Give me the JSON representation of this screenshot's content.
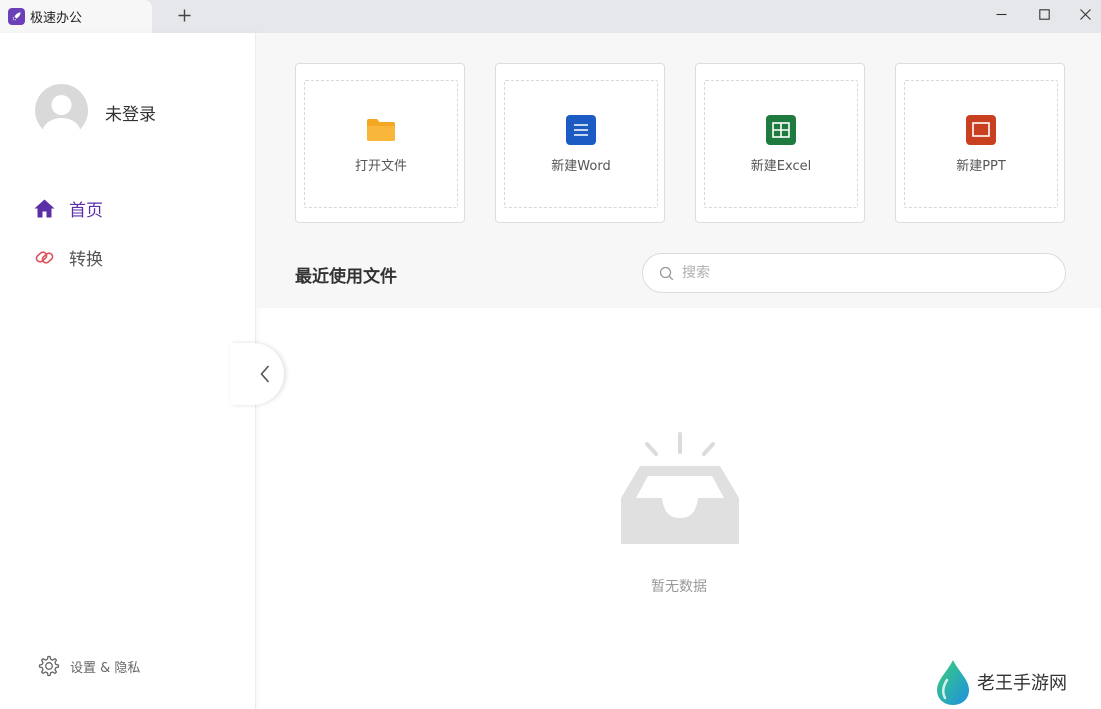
{
  "titlebar": {
    "tab_title": "极速办公",
    "new_tab_symbol": "+"
  },
  "sidebar": {
    "username": "未登录",
    "nav": [
      {
        "label": "首页",
        "active": true
      },
      {
        "label": "转换",
        "active": false
      }
    ],
    "settings_label": "设置 & 隐私"
  },
  "actions": [
    {
      "label": "打开文件",
      "icon": "folder-icon",
      "color": "#f5a623"
    },
    {
      "label": "新建Word",
      "icon": "word-icon",
      "color": "#1d5bc4"
    },
    {
      "label": "新建Excel",
      "icon": "excel-icon",
      "color": "#1f7a3f"
    },
    {
      "label": "新建PPT",
      "icon": "ppt-icon",
      "color": "#c8401f"
    }
  ],
  "recent": {
    "title": "最近使用文件",
    "search_placeholder": "搜索",
    "empty_text": "暂无数据"
  },
  "watermark": {
    "text": "老王手游网"
  },
  "colors": {
    "accent": "#5a2fa8",
    "convert": "#e0525a"
  }
}
